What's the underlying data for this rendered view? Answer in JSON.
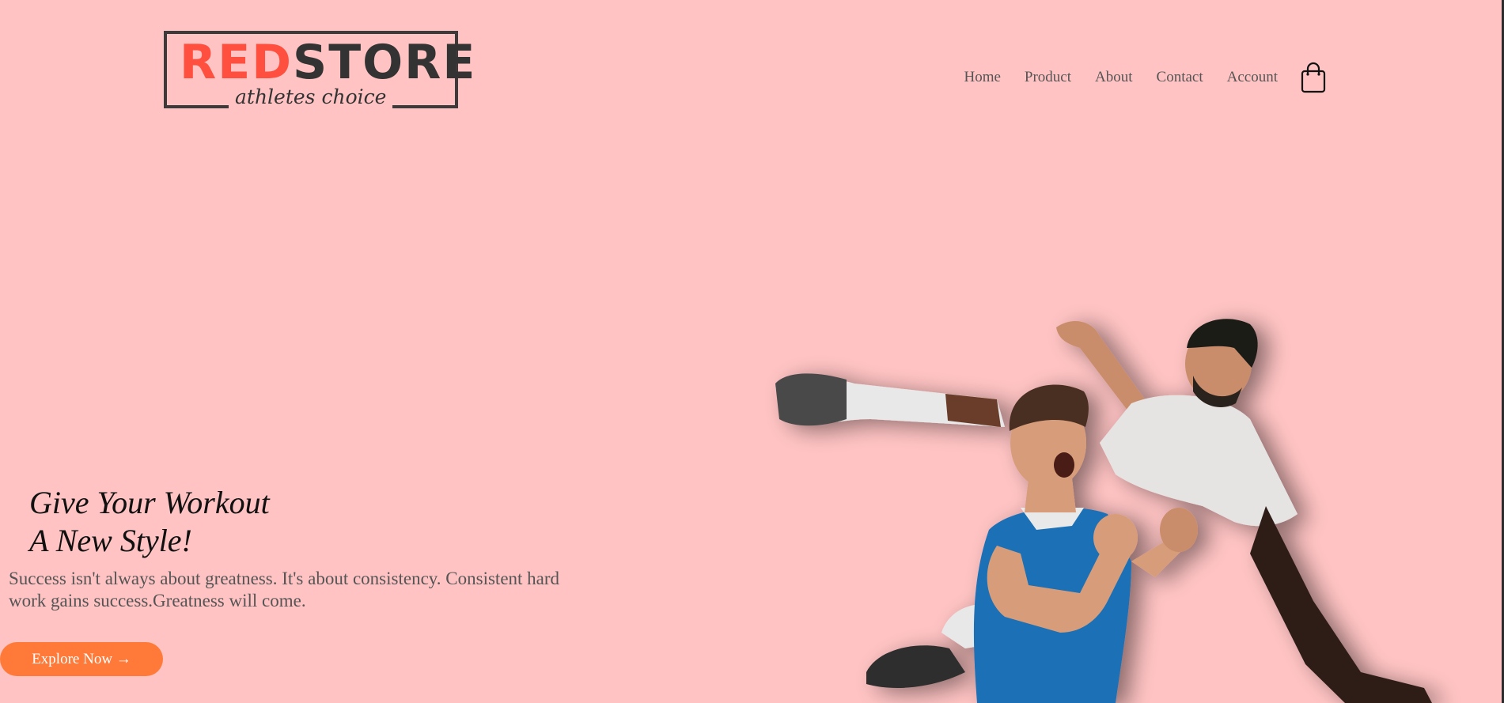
{
  "brand": {
    "logo_part1": "RED",
    "logo_part2": "STORE",
    "tagline": "athletes choice"
  },
  "nav": {
    "items": [
      {
        "label": "Home"
      },
      {
        "label": "Product"
      },
      {
        "label": "About"
      },
      {
        "label": "Contact"
      },
      {
        "label": "Account"
      }
    ],
    "cart_icon": "shopping-bag-icon"
  },
  "hero": {
    "title_line1": "Give Your Workout",
    "title_line2": "A New Style!",
    "text": "Success isn't always about greatness. It's about consistency. Consistent hard work gains success.Greatness will come.",
    "button_label": "Explore Now →"
  },
  "colors": {
    "background": "#ffc3c3",
    "accent": "#ff7a39",
    "logo_red": "#ff4f3f",
    "logo_dark": "#333333"
  }
}
